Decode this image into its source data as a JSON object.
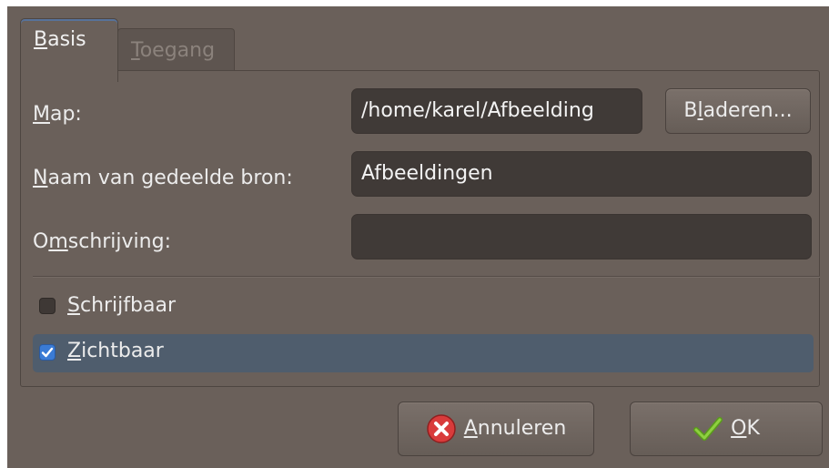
{
  "tabs": [
    {
      "label": "Basis",
      "mnemonic": "B",
      "rest": "asis",
      "active": true
    },
    {
      "label": "Toegang",
      "mnemonic": "T",
      "rest": "oegang",
      "active": false
    }
  ],
  "form": {
    "map": {
      "label_pre": "",
      "label_mn": "M",
      "label_post": "ap:",
      "value": "/home/karel/Afbeelding"
    },
    "browse": {
      "pre": "B",
      "mn": "l",
      "post": "aderen..."
    },
    "share_name": {
      "label_pre": "",
      "label_mn": "N",
      "label_post": "aam van gedeelde bron:",
      "value": "Afbeeldingen"
    },
    "description": {
      "label_pre": "O",
      "label_mn": "m",
      "label_post": "schrijving:",
      "value": ""
    },
    "writable": {
      "mn": "S",
      "post": "chrijfbaar",
      "checked": false
    },
    "visible": {
      "mn": "Z",
      "post": "ichtbaar",
      "checked": true
    }
  },
  "buttons": {
    "cancel": {
      "mn": "A",
      "post": "nnuleren",
      "icon": "cancel-icon"
    },
    "ok": {
      "mn": "O",
      "post": "K",
      "icon": "checkmark-icon"
    }
  },
  "colors": {
    "window": "#6a605a",
    "field": "#403a37",
    "selection": "#4f5d6d",
    "accent": "#3a7bd5"
  }
}
